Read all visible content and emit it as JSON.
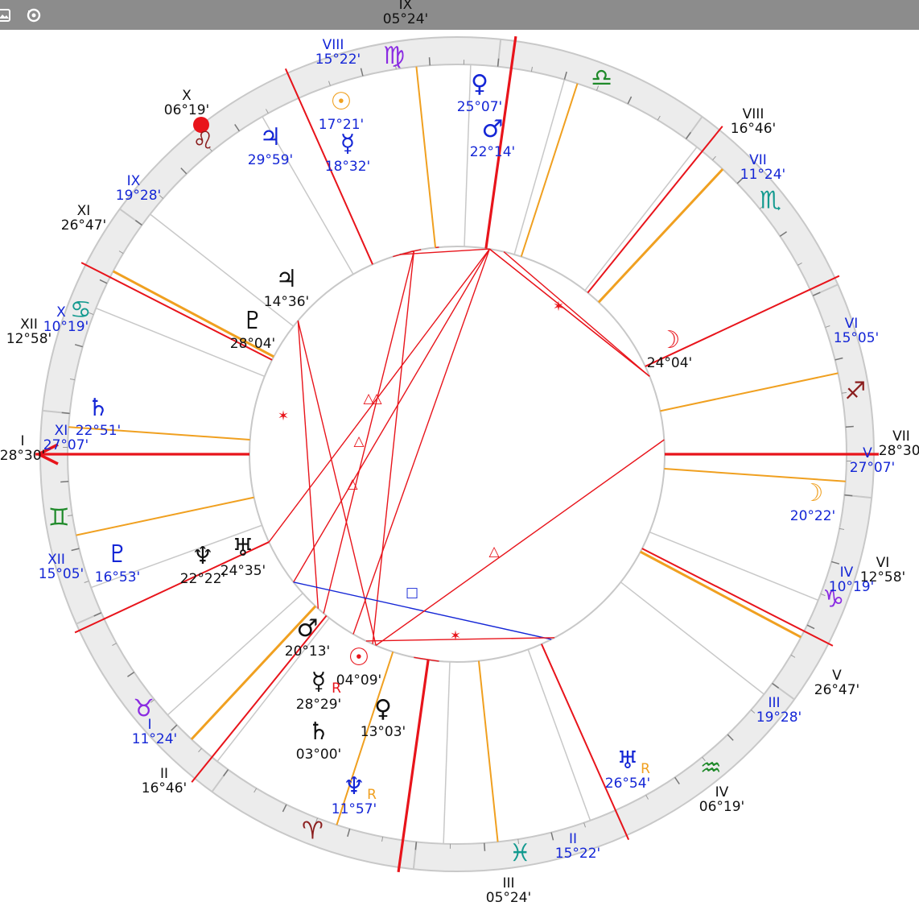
{
  "colors": {
    "ring": "#ececec",
    "ring_stroke": "#c8c8c8",
    "house_line": "#c8c8c8",
    "red": "#e8141b",
    "orange": "#f0a020",
    "blue": "#1426d6",
    "black": "#111111",
    "teal": "#139a8f",
    "purple": "#8a2be2",
    "green": "#1f8a2a",
    "brown": "#8b1e1e",
    "bar": "#8c8c8c"
  },
  "toolbar": {
    "icons": [
      "image-icon",
      "reset-icon"
    ]
  },
  "signs": [
    {
      "name": "virgo",
      "glyph": "♍",
      "color": "#8a2be2"
    },
    {
      "name": "leo",
      "glyph": "♌",
      "color": "#8b1e1e"
    },
    {
      "name": "cancer",
      "glyph": "♋",
      "color": "#139a8f"
    },
    {
      "name": "gemini",
      "glyph": "♊",
      "color": "#1f8a2a"
    },
    {
      "name": "taurus",
      "glyph": "♉",
      "color": "#8a2be2"
    },
    {
      "name": "aries",
      "glyph": "♈",
      "color": "#8b1e1e"
    },
    {
      "name": "pisces",
      "glyph": "♓",
      "color": "#139a8f"
    },
    {
      "name": "aquarius",
      "glyph": "♒",
      "color": "#1f8a2a"
    },
    {
      "name": "capricorn",
      "glyph": "♑",
      "color": "#8a2be2"
    },
    {
      "name": "sagittarius",
      "glyph": "♐",
      "color": "#8b1e1e"
    },
    {
      "name": "scorpio",
      "glyph": "♏",
      "color": "#139a8f"
    },
    {
      "name": "libra",
      "glyph": "♎",
      "color": "#1f8a2a"
    }
  ],
  "houses_primary": [
    {
      "num": "I",
      "deg": "28°30'"
    },
    {
      "num": "II",
      "deg": "16°46'"
    },
    {
      "num": "III",
      "deg": "05°24'"
    },
    {
      "num": "IV",
      "deg": "06°19'"
    },
    {
      "num": "V",
      "deg": "26°47'"
    },
    {
      "num": "VI",
      "deg": "12°58'"
    },
    {
      "num": "VII",
      "deg": "28°30'"
    },
    {
      "num": "VIII",
      "deg": "16°46'"
    },
    {
      "num": "IX",
      "deg": "05°24'"
    },
    {
      "num": "X",
      "deg": "06°19'"
    },
    {
      "num": "XI",
      "deg": "26°47'"
    },
    {
      "num": "XII",
      "deg": "12°58'"
    }
  ],
  "houses_secondary": [
    {
      "num": "I",
      "deg": "11°24'"
    },
    {
      "num": "II",
      "deg": "15°22'"
    },
    {
      "num": "III",
      "deg": "19°28'"
    },
    {
      "num": "IV",
      "deg": "10°19'"
    },
    {
      "num": "V",
      "deg": "27°07'"
    },
    {
      "num": "VI",
      "deg": "15°05'"
    },
    {
      "num": "VII",
      "deg": "11°24'"
    },
    {
      "num": "VIII",
      "deg": "15°22'"
    },
    {
      "num": "IX",
      "deg": "19°28'"
    },
    {
      "num": "X",
      "deg": "10°19'"
    },
    {
      "num": "XI",
      "deg": "27°07'"
    },
    {
      "num": "XII",
      "deg": "15°05'"
    }
  ],
  "planets_inner": [
    {
      "name": "jupiter",
      "glyph": "♃",
      "deg": "14°36'",
      "retro": ""
    },
    {
      "name": "pluto",
      "glyph": "♇",
      "deg": "28°04'",
      "retro": ""
    },
    {
      "name": "neptune",
      "glyph": "♆",
      "deg": "22°22'",
      "retro": ""
    },
    {
      "name": "uranus",
      "glyph": "♅",
      "deg": "24°35'",
      "retro": ""
    },
    {
      "name": "mars",
      "glyph": "♂",
      "deg": "20°13'",
      "retro": ""
    },
    {
      "name": "sun",
      "glyph": "☉",
      "deg": "04°09'",
      "retro": ""
    },
    {
      "name": "mercury",
      "glyph": "☿",
      "deg": "28°29'",
      "retro": "R"
    },
    {
      "name": "venus",
      "glyph": "♀",
      "deg": "13°03'",
      "retro": ""
    },
    {
      "name": "saturn",
      "glyph": "♄",
      "deg": "03°00'",
      "retro": ""
    },
    {
      "name": "moon",
      "glyph": "☽",
      "deg": "24°04'",
      "retro": ""
    }
  ],
  "planets_outer": [
    {
      "name": "venus",
      "glyph": "♀",
      "deg": "25°07'",
      "retro": ""
    },
    {
      "name": "mars",
      "glyph": "♂",
      "deg": "22°14'",
      "retro": ""
    },
    {
      "name": "sun",
      "glyph": "☉",
      "deg": "17°21'",
      "retro": ""
    },
    {
      "name": "mercury",
      "glyph": "☿",
      "deg": "18°32'",
      "retro": ""
    },
    {
      "name": "jupiter",
      "glyph": "♃",
      "deg": "29°59'",
      "retro": ""
    },
    {
      "name": "saturn",
      "glyph": "♄",
      "deg": "22°51'",
      "retro": ""
    },
    {
      "name": "pluto",
      "glyph": "♇",
      "deg": "16°53'",
      "retro": ""
    },
    {
      "name": "neptune",
      "glyph": "♆",
      "deg": "11°57'",
      "retro": "R"
    },
    {
      "name": "uranus",
      "glyph": "♅",
      "deg": "26°54'",
      "retro": "R"
    },
    {
      "name": "moon",
      "glyph": "☽",
      "deg": "20°22'",
      "retro": ""
    }
  ],
  "aspect_symbols": {
    "trine": "△",
    "sextile": "✶",
    "square": "□",
    "opposition": "☍"
  }
}
